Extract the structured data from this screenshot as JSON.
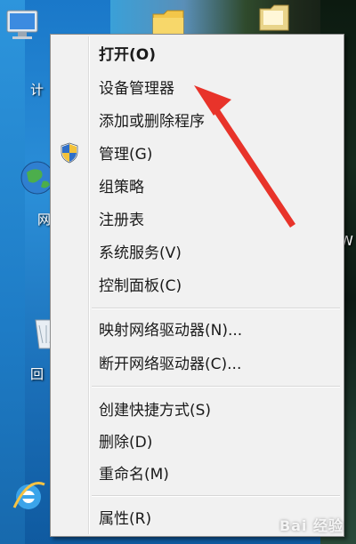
{
  "desktop": {
    "labels": {
      "computer": "计",
      "network": "网",
      "recycle": "回",
      "right_fragment": "W"
    }
  },
  "menu": {
    "items": [
      {
        "label": "打开(O)",
        "bold": true
      },
      {
        "label": "设备管理器"
      },
      {
        "label": "添加或删除程序"
      },
      {
        "label": "管理(G)",
        "icon": "uac-shield-icon"
      },
      {
        "label": "组策略"
      },
      {
        "label": "注册表"
      },
      {
        "label": "系统服务(V)"
      },
      {
        "label": "控制面板(C)"
      },
      {
        "label": "映射网络驱动器(N)..."
      },
      {
        "label": "断开网络驱动器(C)..."
      },
      {
        "label": "创建快捷方式(S)"
      },
      {
        "label": "删除(D)"
      },
      {
        "label": "重命名(M)"
      },
      {
        "label": "属性(R)"
      }
    ]
  },
  "annotation": {
    "arrow_color": "#e8332a"
  },
  "watermark": {
    "text": "Bai 经验"
  }
}
